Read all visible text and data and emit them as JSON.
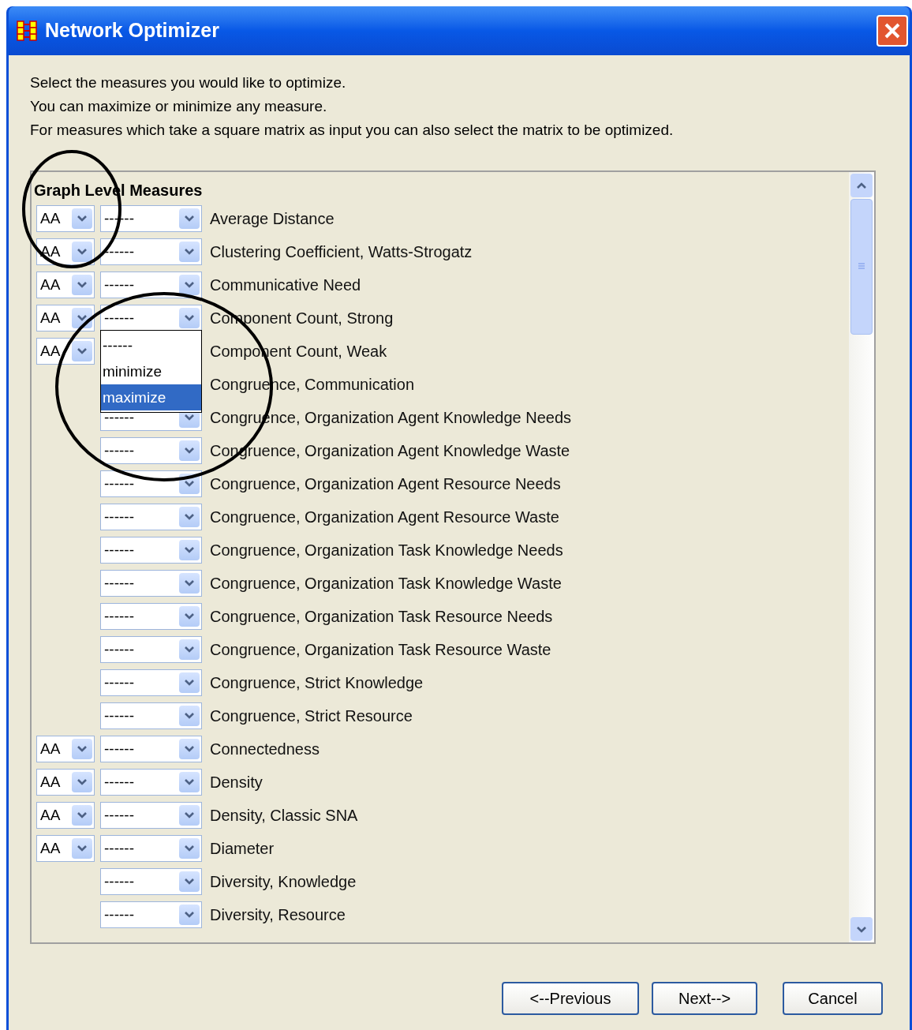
{
  "window": {
    "title": "Network Optimizer"
  },
  "instructions": [
    "Select the measures you would like to optimize.",
    "You can maximize or minimize any measure.",
    "For measures which take a square matrix as input you can also select the matrix to be optimized."
  ],
  "section_title": "Graph Level Measures",
  "rows": [
    {
      "matrix": "AA",
      "direction": "------",
      "label": "Average Distance"
    },
    {
      "matrix": "AA",
      "direction": "------",
      "label": "Clustering Coefficient, Watts-Strogatz"
    },
    {
      "matrix": "AA",
      "direction": "------",
      "label": "Communicative Need"
    },
    {
      "matrix": "AA",
      "direction": "------",
      "label": "Component Count, Strong",
      "menu": {
        "options": [
          {
            "label": "------",
            "selected": false
          },
          {
            "label": "minimize",
            "selected": false
          },
          {
            "label": "maximize",
            "selected": true
          }
        ]
      }
    },
    {
      "matrix": "AA",
      "label": "Component Count, Weak"
    },
    {
      "label": "Congruence, Communication"
    },
    {
      "direction": "------",
      "label": "Congruence, Organization Agent Knowledge Needs"
    },
    {
      "direction": "------",
      "label": "Congruence, Organization Agent Knowledge Waste"
    },
    {
      "direction": "------",
      "label": "Congruence, Organization Agent Resource Needs"
    },
    {
      "direction": "------",
      "label": "Congruence, Organization Agent Resource Waste"
    },
    {
      "direction": "------",
      "label": "Congruence, Organization Task Knowledge Needs"
    },
    {
      "direction": "------",
      "label": "Congruence, Organization Task Knowledge Waste"
    },
    {
      "direction": "------",
      "label": "Congruence, Organization Task Resource Needs"
    },
    {
      "direction": "------",
      "label": "Congruence, Organization Task Resource Waste"
    },
    {
      "direction": "------",
      "label": "Congruence, Strict Knowledge"
    },
    {
      "direction": "------",
      "label": "Congruence, Strict Resource"
    },
    {
      "matrix": "AA",
      "direction": "------",
      "label": "Connectedness"
    },
    {
      "matrix": "AA",
      "direction": "------",
      "label": "Density"
    },
    {
      "matrix": "AA",
      "direction": "------",
      "label": "Density, Classic SNA"
    },
    {
      "matrix": "AA",
      "direction": "------",
      "label": "Diameter"
    },
    {
      "direction": "------",
      "label": "Diversity, Knowledge"
    },
    {
      "direction": "------",
      "label": "Diversity, Resource"
    }
  ],
  "buttons": [
    "<--Previous",
    "Next-->",
    "Cancel"
  ]
}
